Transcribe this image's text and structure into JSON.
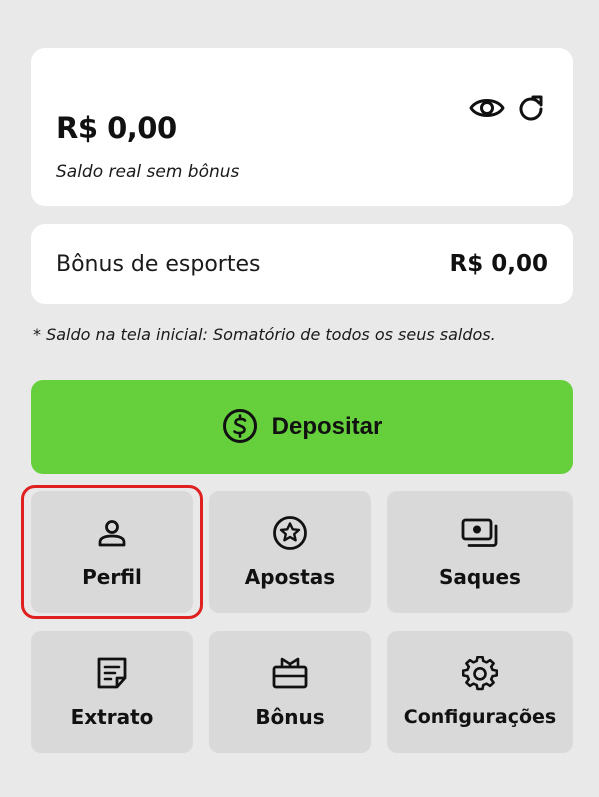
{
  "balance": {
    "amount": "R$ 0,00",
    "subtitle": "Saldo real sem bônus",
    "icons": [
      "eye-icon",
      "refresh-icon"
    ]
  },
  "bonus": {
    "label": "Bônus de esportes",
    "value": "R$ 0,00"
  },
  "note": "* Saldo na tela inicial: Somatório de todos os seus saldos.",
  "deposit": {
    "label": "Depositar",
    "icon": "dollar-circle-icon",
    "color": "#66d03c"
  },
  "menu": {
    "items": [
      {
        "label": "Perfil",
        "icon": "user-icon"
      },
      {
        "label": "Apostas",
        "icon": "star-circle-icon"
      },
      {
        "label": "Saques",
        "icon": "money-stack-icon"
      },
      {
        "label": "Extrato",
        "icon": "document-icon"
      },
      {
        "label": "Bônus",
        "icon": "gift-icon"
      },
      {
        "label": "Configurações",
        "icon": "gear-icon"
      }
    ]
  },
  "highlight_color": "#e02020"
}
